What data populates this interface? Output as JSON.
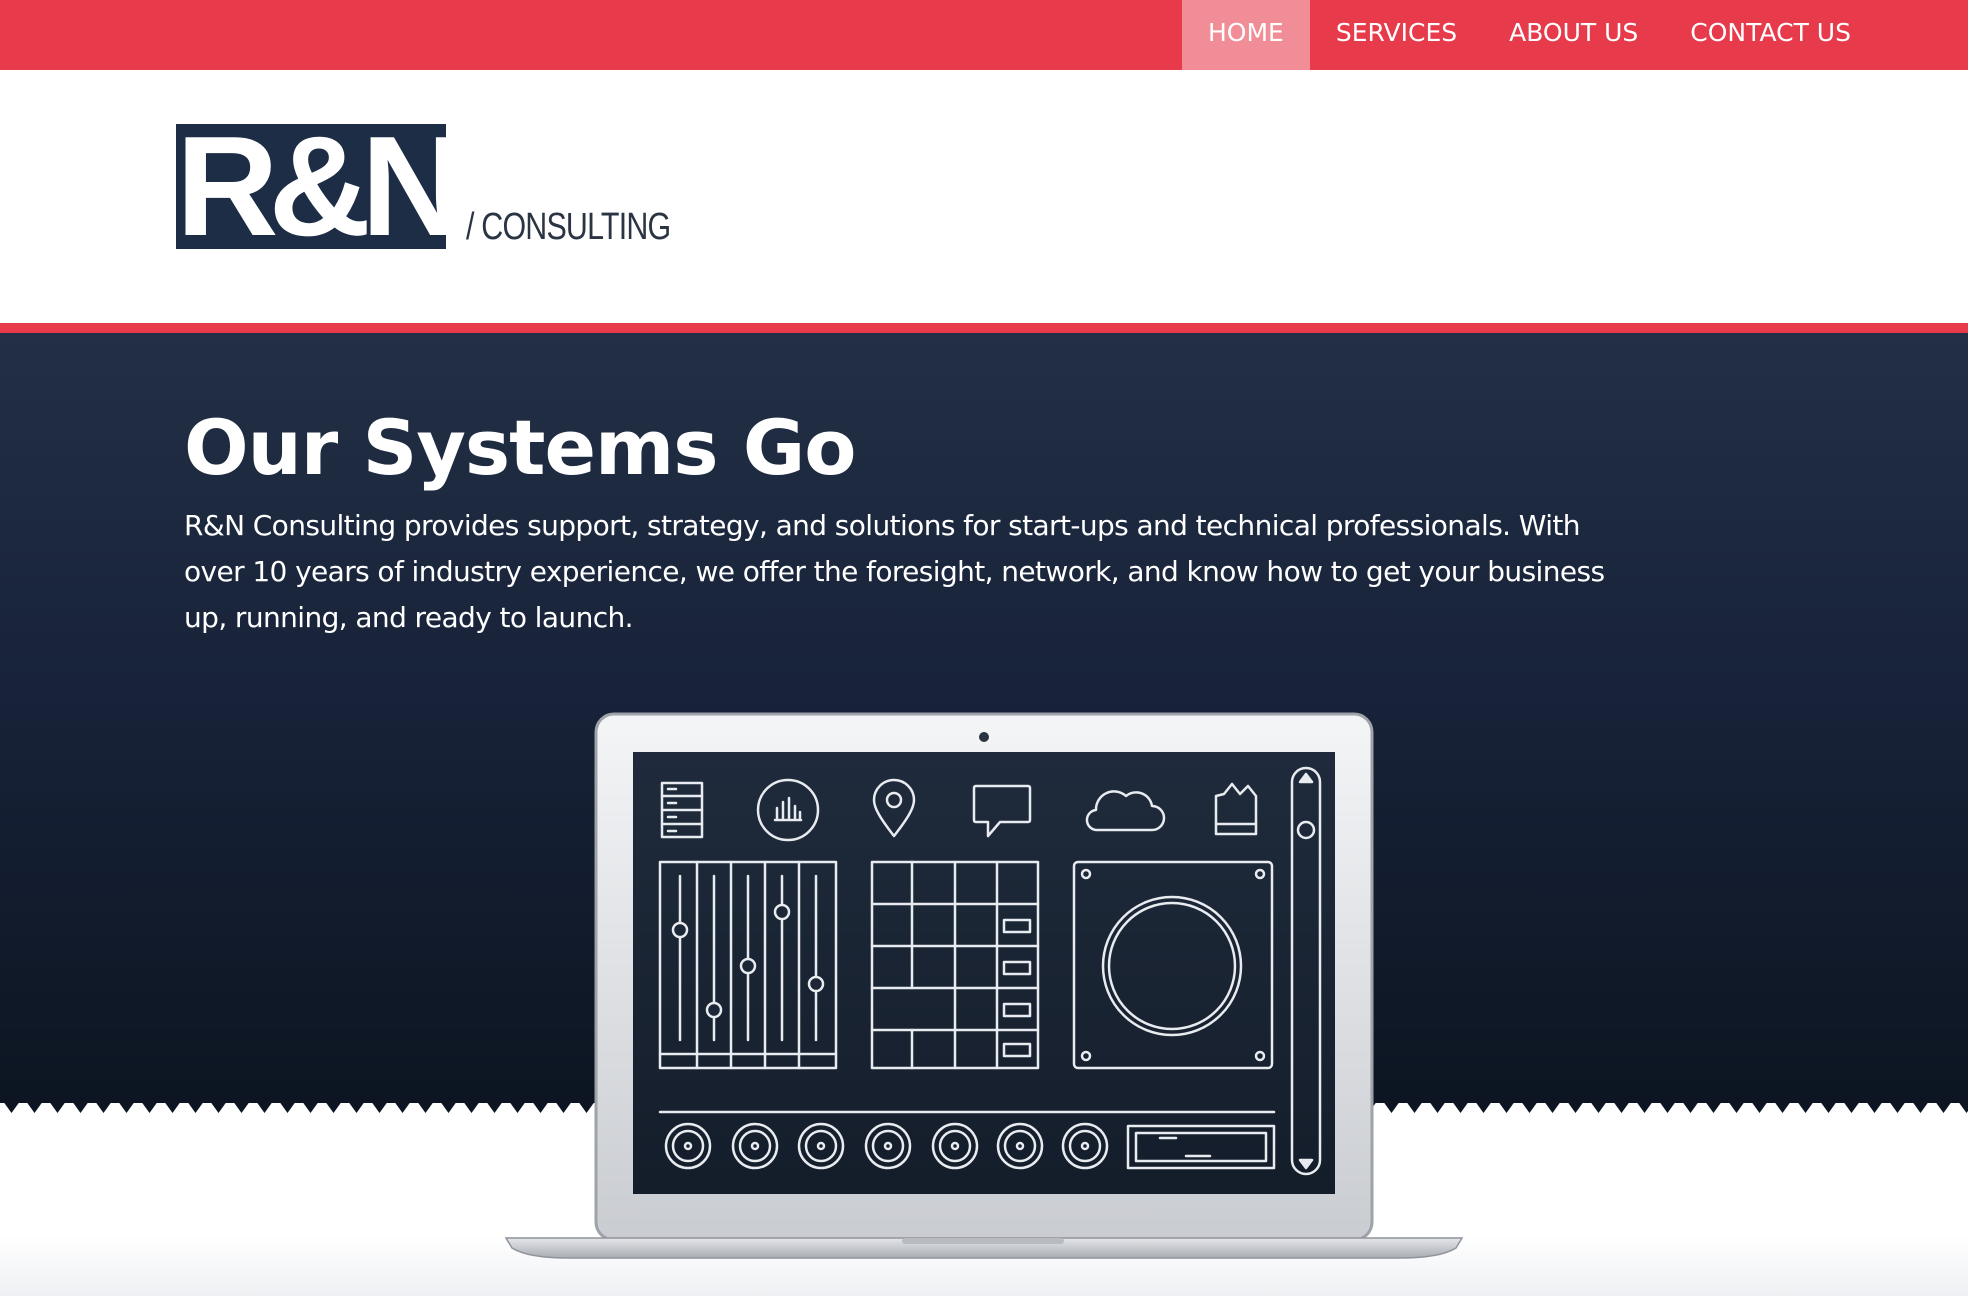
{
  "nav": {
    "items": [
      {
        "label": "HOME",
        "active": true
      },
      {
        "label": "SERVICES",
        "active": false
      },
      {
        "label": "ABOUT US",
        "active": false
      },
      {
        "label": "CONTACT US",
        "active": false
      }
    ]
  },
  "logo": {
    "mark": "R&N",
    "subtitle": "/ CONSULTING"
  },
  "hero": {
    "title": "Our Systems Go",
    "text": "R&N Consulting provides support, strategy, and solutions for start-ups and technical professionals. With over 10 years of industry experience, we offer the foresight, network, and know how to get your business up, running, and ready to launch."
  },
  "laptop_screen": {
    "icons": [
      "server-icon",
      "chart-icon",
      "location-pin-icon",
      "chat-icon",
      "cloud-icon",
      "shopping-bag-icon"
    ]
  },
  "colors": {
    "accent": "#e73b4c",
    "accent_light": "#f08d96",
    "navy": "#1d2d45",
    "hero_dark": "#0c1521"
  }
}
